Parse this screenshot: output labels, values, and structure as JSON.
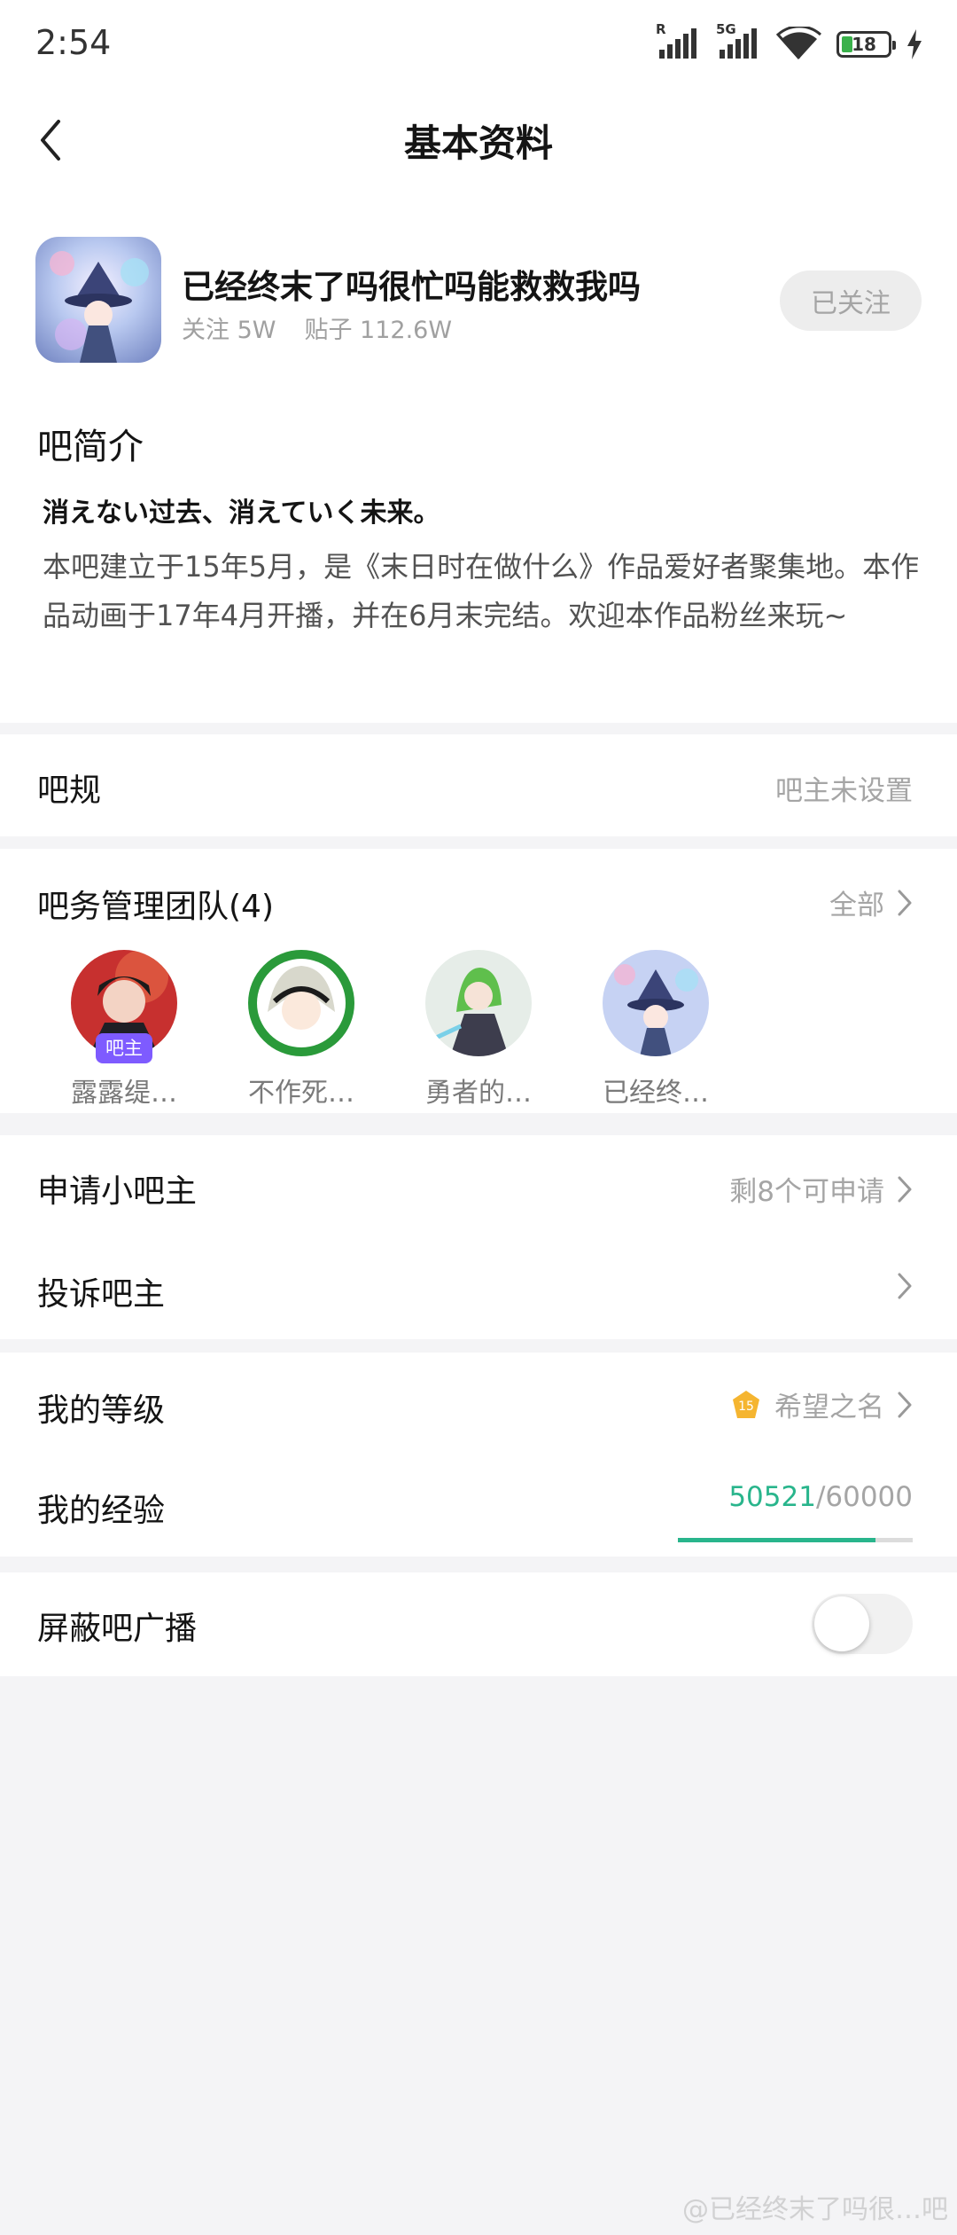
{
  "status_bar": {
    "time": "2:54",
    "sim1_tag": "R",
    "sim2_tag": "5G",
    "battery": "18"
  },
  "nav": {
    "title": "基本资料"
  },
  "forum": {
    "name": "已经终末了吗很忙吗能救救我吗",
    "followers": "关注 5W",
    "posts": "贴子 112.6W",
    "follow_button": "已关注"
  },
  "intro": {
    "title": "吧简介",
    "tagline": "消えない过去、消えていく未来。",
    "description": "本吧建立于15年5月，是《末日时在做什么》作品爱好者聚集地。本作品动画于17年4月开播，并在6月末完结。欢迎本作品粉丝来玩~"
  },
  "rules": {
    "label": "吧规",
    "value": "吧主未设置"
  },
  "team": {
    "label": "吧务管理团队(4)",
    "all_link": "全部",
    "owner_badge": "吧主",
    "members": [
      {
        "name": "露露缇…"
      },
      {
        "name": "不作死…"
      },
      {
        "name": "勇者的…"
      },
      {
        "name": "已经终…"
      }
    ]
  },
  "apply": {
    "label": "申请小吧主",
    "value": "剩8个可申请"
  },
  "complain": {
    "label": "投诉吧主"
  },
  "level": {
    "label": "我的等级",
    "badge_number": "15",
    "title": "希望之名"
  },
  "experience": {
    "label": "我的经验",
    "current": "50521",
    "total": "/60000",
    "progress": 0.842
  },
  "block_broadcast": {
    "label": "屏蔽吧广播",
    "enabled": false
  },
  "watermark": "@已经终末了吗很…吧",
  "colors": {
    "accent": "#29b58c",
    "owner_badge": "#7e5bff",
    "level_badge": "#f5b530"
  }
}
